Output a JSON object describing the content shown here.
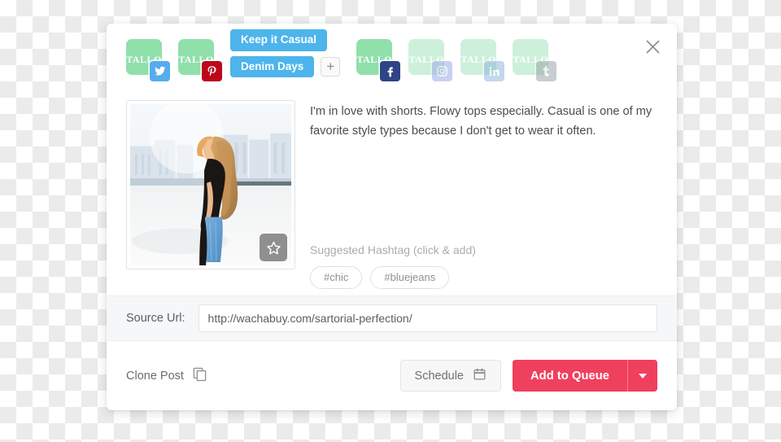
{
  "modal": {
    "close_icon": "close-x-icon",
    "accounts": [
      {
        "wordmark": "TALLO",
        "network": "twitter",
        "badge_icon": "twitter-icon",
        "active": true
      },
      {
        "wordmark": "TALLO",
        "network": "pinterest",
        "badge_icon": "pinterest-icon",
        "active": true
      },
      {
        "wordmark": "TALLO",
        "network": "facebook",
        "badge_icon": "facebook-icon",
        "active": true
      },
      {
        "wordmark": "TALLO",
        "network": "instagram",
        "badge_icon": "instagram-icon",
        "active": false
      },
      {
        "wordmark": "TALLO",
        "network": "linkedin",
        "badge_icon": "linkedin-icon",
        "active": false
      },
      {
        "wordmark": "TALLO",
        "network": "tumblr",
        "badge_icon": "tumblr-icon",
        "active": false
      }
    ],
    "tags": [
      {
        "label": "Keep it Casual"
      },
      {
        "label": "Denim Days"
      }
    ],
    "add_tag_label": "+",
    "post": {
      "text": "I'm in love with shorts. Flowy tops especially. Casual is one of my favorite style types because I don't get to wear it often.",
      "favorite_icon": "star-icon",
      "image_alt": "woman in black top and blue jeans on rooftop"
    },
    "hashtags": {
      "label": "Suggested Hashtag (click & add)",
      "items": [
        "#chic",
        "#bluejeans"
      ]
    },
    "source_url": {
      "label": "Source Url:",
      "value": "http://wachabuy.com/sartorial-perfection/",
      "placeholder": "http://"
    },
    "footer": {
      "clone_label": "Clone Post",
      "clone_icon": "copy-icon",
      "schedule_label": "Schedule",
      "schedule_icon": "calendar-icon",
      "queue_label": "Add to Queue",
      "queue_caret_icon": "chevron-down-icon"
    }
  },
  "colors": {
    "accent_pink": "#ef405e",
    "tag_blue": "#4db4ec",
    "avatar_green": "#8fe0ab",
    "avatar_green_dim": "#cdf0da",
    "twitter": "#55acee",
    "pinterest": "#bd081c",
    "facebook": "#2d4486",
    "instagram": "#9aa7e8",
    "linkedin": "#8fb4dd",
    "tumblr": "#96a0aa"
  }
}
